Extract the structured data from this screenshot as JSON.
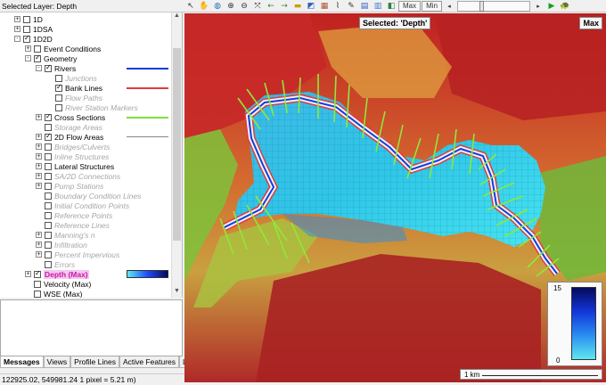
{
  "toolbar": {
    "selected_layer": "Selected Layer: Depth",
    "max_button": "Max",
    "min_button": "Min",
    "icons": [
      "pointer-icon",
      "pan-hand-icon",
      "globe-icon",
      "zoom-in-icon",
      "zoom-out-icon",
      "zoom-extent-icon",
      "back-arrow-icon",
      "forward-arrow-icon",
      "ruler-icon",
      "layers-icon",
      "map-layers-icon",
      "profile-icon",
      "edit-icon",
      "terrain-icon",
      "chart-icon",
      "3d-icon"
    ],
    "colors": {
      "play": "#1b9b1b"
    }
  },
  "tree": {
    "rows": [
      {
        "label": "1D",
        "indent": 0,
        "expander": "+",
        "checkbox": "off",
        "style": "normal"
      },
      {
        "label": "1DSA",
        "indent": 0,
        "expander": "+",
        "checkbox": "off",
        "style": "normal"
      },
      {
        "label": "1D2D",
        "indent": 0,
        "expander": "-",
        "checkbox": "on",
        "style": "normal"
      },
      {
        "label": "Event Conditions",
        "indent": 1,
        "expander": "+",
        "checkbox": "off",
        "style": "normal"
      },
      {
        "label": "Geometry",
        "indent": 1,
        "expander": "-",
        "checkbox": "on",
        "style": "normal"
      },
      {
        "label": "Rivers",
        "indent": 2,
        "expander": "-",
        "checkbox": "on",
        "style": "normal",
        "legend": "#1a3ad6"
      },
      {
        "label": "Junctions",
        "indent": 3,
        "expander": "",
        "checkbox": "off",
        "style": "disabled"
      },
      {
        "label": "Bank Lines",
        "indent": 3,
        "expander": "",
        "checkbox": "on",
        "style": "normal",
        "legend": "#e23a3a"
      },
      {
        "label": "Flow Paths",
        "indent": 3,
        "expander": "",
        "checkbox": "off",
        "style": "disabled"
      },
      {
        "label": "River Station Markers",
        "indent": 3,
        "expander": "",
        "checkbox": "off",
        "style": "disabled"
      },
      {
        "label": "Cross Sections",
        "indent": 2,
        "expander": "+",
        "checkbox": "on",
        "style": "normal",
        "legend": "#7fe03a"
      },
      {
        "label": "Storage Areas",
        "indent": 2,
        "expander": "",
        "checkbox": "off",
        "style": "disabled"
      },
      {
        "label": "2D Flow Areas",
        "indent": 2,
        "expander": "+",
        "checkbox": "on",
        "style": "normal",
        "legend": "#888888"
      },
      {
        "label": "Bridges/Culverts",
        "indent": 2,
        "expander": "+",
        "checkbox": "off",
        "style": "disabled"
      },
      {
        "label": "Inline Structures",
        "indent": 2,
        "expander": "+",
        "checkbox": "off",
        "style": "disabled"
      },
      {
        "label": "Lateral Structures",
        "indent": 2,
        "expander": "+",
        "checkbox": "off",
        "style": "normal"
      },
      {
        "label": "SA/2D Connections",
        "indent": 2,
        "expander": "+",
        "checkbox": "off",
        "style": "disabled"
      },
      {
        "label": "Pump Stations",
        "indent": 2,
        "expander": "+",
        "checkbox": "off",
        "style": "disabled"
      },
      {
        "label": "Boundary Condition Lines",
        "indent": 2,
        "expander": "",
        "checkbox": "off",
        "style": "disabled"
      },
      {
        "label": "Initial Condition Points",
        "indent": 2,
        "expander": "",
        "checkbox": "off",
        "style": "disabled"
      },
      {
        "label": "Reference Points",
        "indent": 2,
        "expander": "",
        "checkbox": "off",
        "style": "disabled"
      },
      {
        "label": "Reference Lines",
        "indent": 2,
        "expander": "",
        "checkbox": "off",
        "style": "disabled"
      },
      {
        "label": "Manning's n",
        "indent": 2,
        "expander": "+",
        "checkbox": "off",
        "style": "disabled"
      },
      {
        "label": "Infiltration",
        "indent": 2,
        "expander": "+",
        "checkbox": "off",
        "style": "disabled"
      },
      {
        "label": "Percent Impervious",
        "indent": 2,
        "expander": "+",
        "checkbox": "off",
        "style": "disabled"
      },
      {
        "label": "Errors",
        "indent": 2,
        "expander": "",
        "checkbox": "off",
        "style": "disabled"
      },
      {
        "label": "Depth (Max)",
        "indent": 1,
        "expander": "+",
        "checkbox": "on",
        "style": "selected",
        "legend": "gradient"
      },
      {
        "label": "Velocity (Max)",
        "indent": 1,
        "expander": "",
        "checkbox": "off",
        "style": "normal"
      },
      {
        "label": "WSE (Max)",
        "indent": 1,
        "expander": "",
        "checkbox": "off",
        "style": "normal"
      }
    ]
  },
  "tabs": [
    "Messages",
    "Views",
    "Profile Lines",
    "Active Features",
    "L"
  ],
  "map": {
    "title": "Selected: 'Depth'",
    "max_label": "Max",
    "scale_max": "15",
    "scale_min": "0",
    "km_label": "1 km"
  },
  "status": "122925.02, 549981.24  1 pixel = 5.21 m)"
}
